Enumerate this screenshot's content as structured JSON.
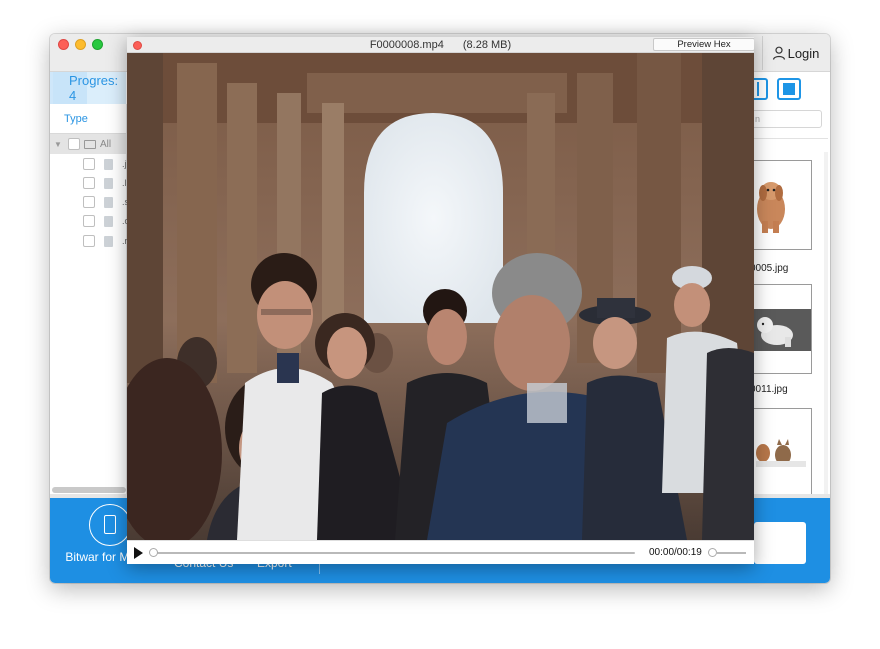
{
  "main_window": {
    "login_label": "Login",
    "progress_tab_label": "Progres: 4",
    "type_header": "Type",
    "tree": {
      "all_label": "All",
      "files": [
        ".j",
        ".l",
        ".s",
        ".c",
        ".r"
      ]
    },
    "search_placeholder": "n",
    "thumbnails": [
      {
        "label": "0005.jpg"
      },
      {
        "label": "0011.jpg"
      },
      {
        "label": ""
      }
    ],
    "bottom": {
      "mobile_label": "Bitwar for Mobile",
      "contact_label": "Contact Us",
      "export_label": "Export"
    }
  },
  "preview": {
    "filename": "F0000008.mp4",
    "filesize": "(8.28 MB)",
    "hex_button": "Preview Hex",
    "time": "00:00/00:19",
    "progress": 0.0
  },
  "colors": {
    "accent": "#1e8fe3",
    "close": "#fc5f57",
    "minimize": "#fdbc2e",
    "zoom": "#28c840"
  }
}
